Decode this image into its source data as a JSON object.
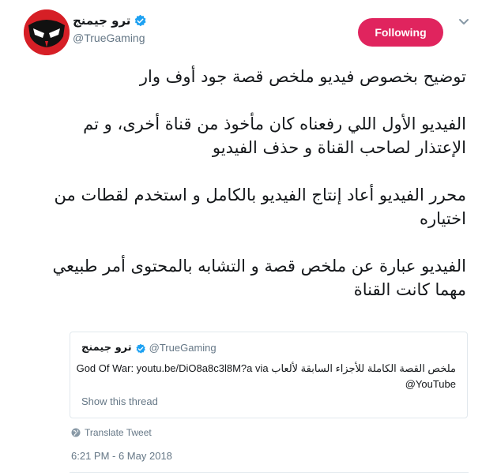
{
  "author": {
    "display_name": "ترو جيمنج",
    "handle": "@TrueGaming",
    "verified_icon": "verified-badge-icon",
    "avatar_icon": "mask-logo-icon"
  },
  "follow_button": {
    "label": "Following",
    "color": "#e0245e"
  },
  "menu_icon": "chevron-down-icon",
  "tweet": {
    "paragraphs": [
      "توضيح بخصوص فيديو ملخص قصة جود أوف وار",
      "الفيديو الأول اللي رفعناه كان مأخوذ من قناة أخرى، و تم الإعتذار لصاحب القناة و حذف الفيديو",
      "محرر الفيديو أعاد إنتاج الفيديو بالكامل و استخدم لقطات من اختياره",
      "الفيديو عبارة عن ملخص قصة و التشابه بالمحتوى أمر طبيعي مهما كانت القناة"
    ]
  },
  "quoted_tweet": {
    "display_name": "ترو جيمنج",
    "handle": "@TrueGaming",
    "text_line1": "ملخص القصة الكاملة للأجزاء السابقة لألعاب God Of War: youtu.be/DiO8a8c3l8M?a via",
    "text_line2": "@YouTube",
    "show_thread_label": "Show this thread"
  },
  "translate": {
    "label": "Translate Tweet",
    "icon": "globe-icon"
  },
  "timestamp": "6:21 PM - 6 May 2018",
  "colors": {
    "accent": "#e0245e",
    "verified": "#1da1f2",
    "muted_text": "#657786",
    "avatar_red": "#d61f26"
  }
}
